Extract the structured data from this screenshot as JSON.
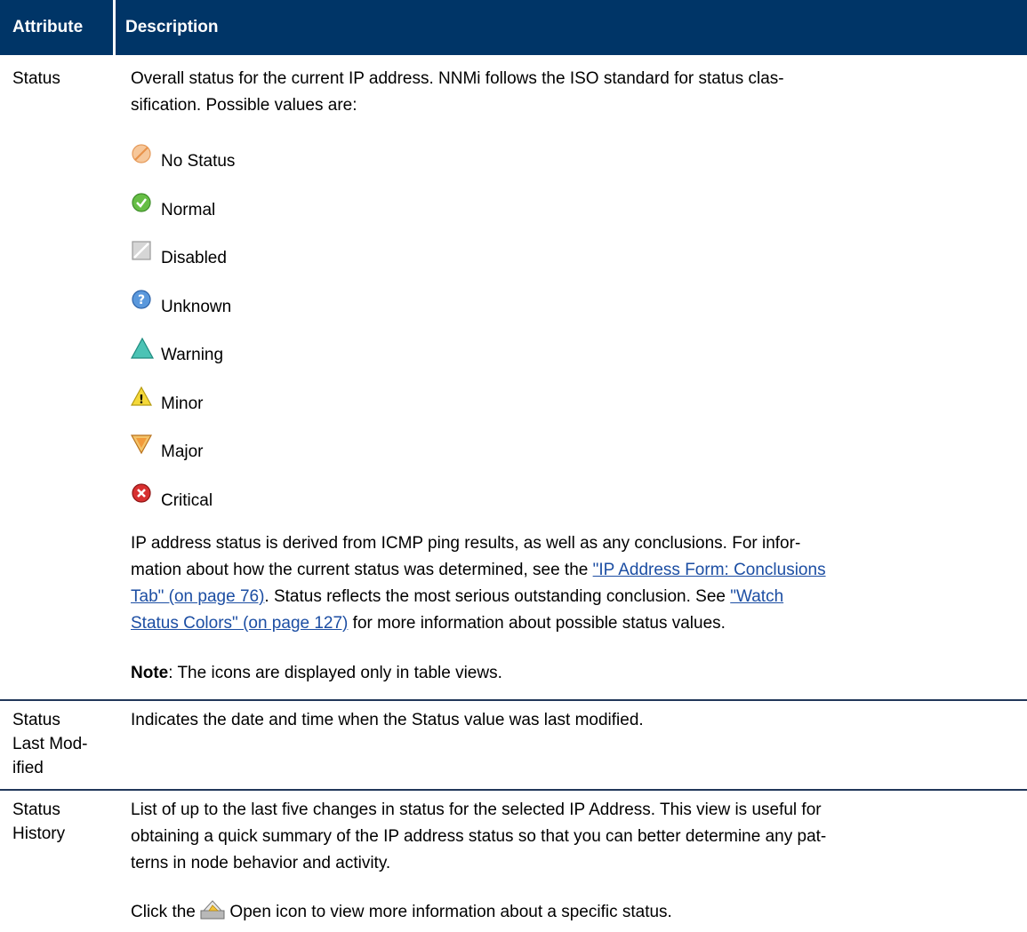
{
  "header": {
    "attribute": "Attribute",
    "description": "Description"
  },
  "rows": [
    {
      "attribute": "Status",
      "paragraph1_line1": "Overall status for the current IP address. NNMi follows the ISO standard for status clas-",
      "paragraph1_line2": "sification. Possible values are:",
      "statuses": [
        {
          "label": "No Status",
          "icon": "no-status-icon",
          "color": "#f3b47c"
        },
        {
          "label": "Normal",
          "icon": "normal-icon",
          "color": "#5cb43c"
        },
        {
          "label": "Disabled",
          "icon": "disabled-icon",
          "color": "#bcbcbc"
        },
        {
          "label": "Unknown",
          "icon": "unknown-icon",
          "color": "#4f8fd6"
        },
        {
          "label": "Warning",
          "icon": "warning-icon",
          "color": "#3bb6a8"
        },
        {
          "label": "Minor",
          "icon": "minor-icon",
          "color": "#f2d21c"
        },
        {
          "label": "Major",
          "icon": "major-icon",
          "color": "#f2a23c"
        },
        {
          "label": "Critical",
          "icon": "critical-icon",
          "color": "#d22b2b"
        }
      ],
      "paragraph2": {
        "line1": "IP address status is derived from ICMP ping results, as well as any conclusions. For infor-",
        "line2_pre": "mation about how the current status was determined, see the ",
        "line2_link": "\"IP Address Form: Conclusions",
        "line3_link": "Tab\" (on page 76)",
        "line3_mid": ". Status reflects the most serious outstanding conclusion. See ",
        "line3_link2": "\"Watch",
        "line4_link": "Status Colors\" (on page 127)",
        "line4_post": " for more information about possible status values."
      },
      "note_label": "Note",
      "note_text": ": The icons are displayed only in table views."
    },
    {
      "attribute_lines": [
        "Status",
        "Last Mod-",
        "ified"
      ],
      "description": "Indicates the date and time when the Status value was last modified."
    },
    {
      "attribute_lines": [
        "Status",
        "History"
      ],
      "desc_line1": "List of up to the last five changes in status for the selected IP Address. This view is useful for",
      "desc_line2": "obtaining a quick summary of the IP address status so that you can better determine any pat-",
      "desc_line3": "terns in node behavior and activity.",
      "click_pre": "Click the ",
      "click_icon": "open-icon",
      "click_post": " Open icon to view more information about a specific status."
    }
  ]
}
